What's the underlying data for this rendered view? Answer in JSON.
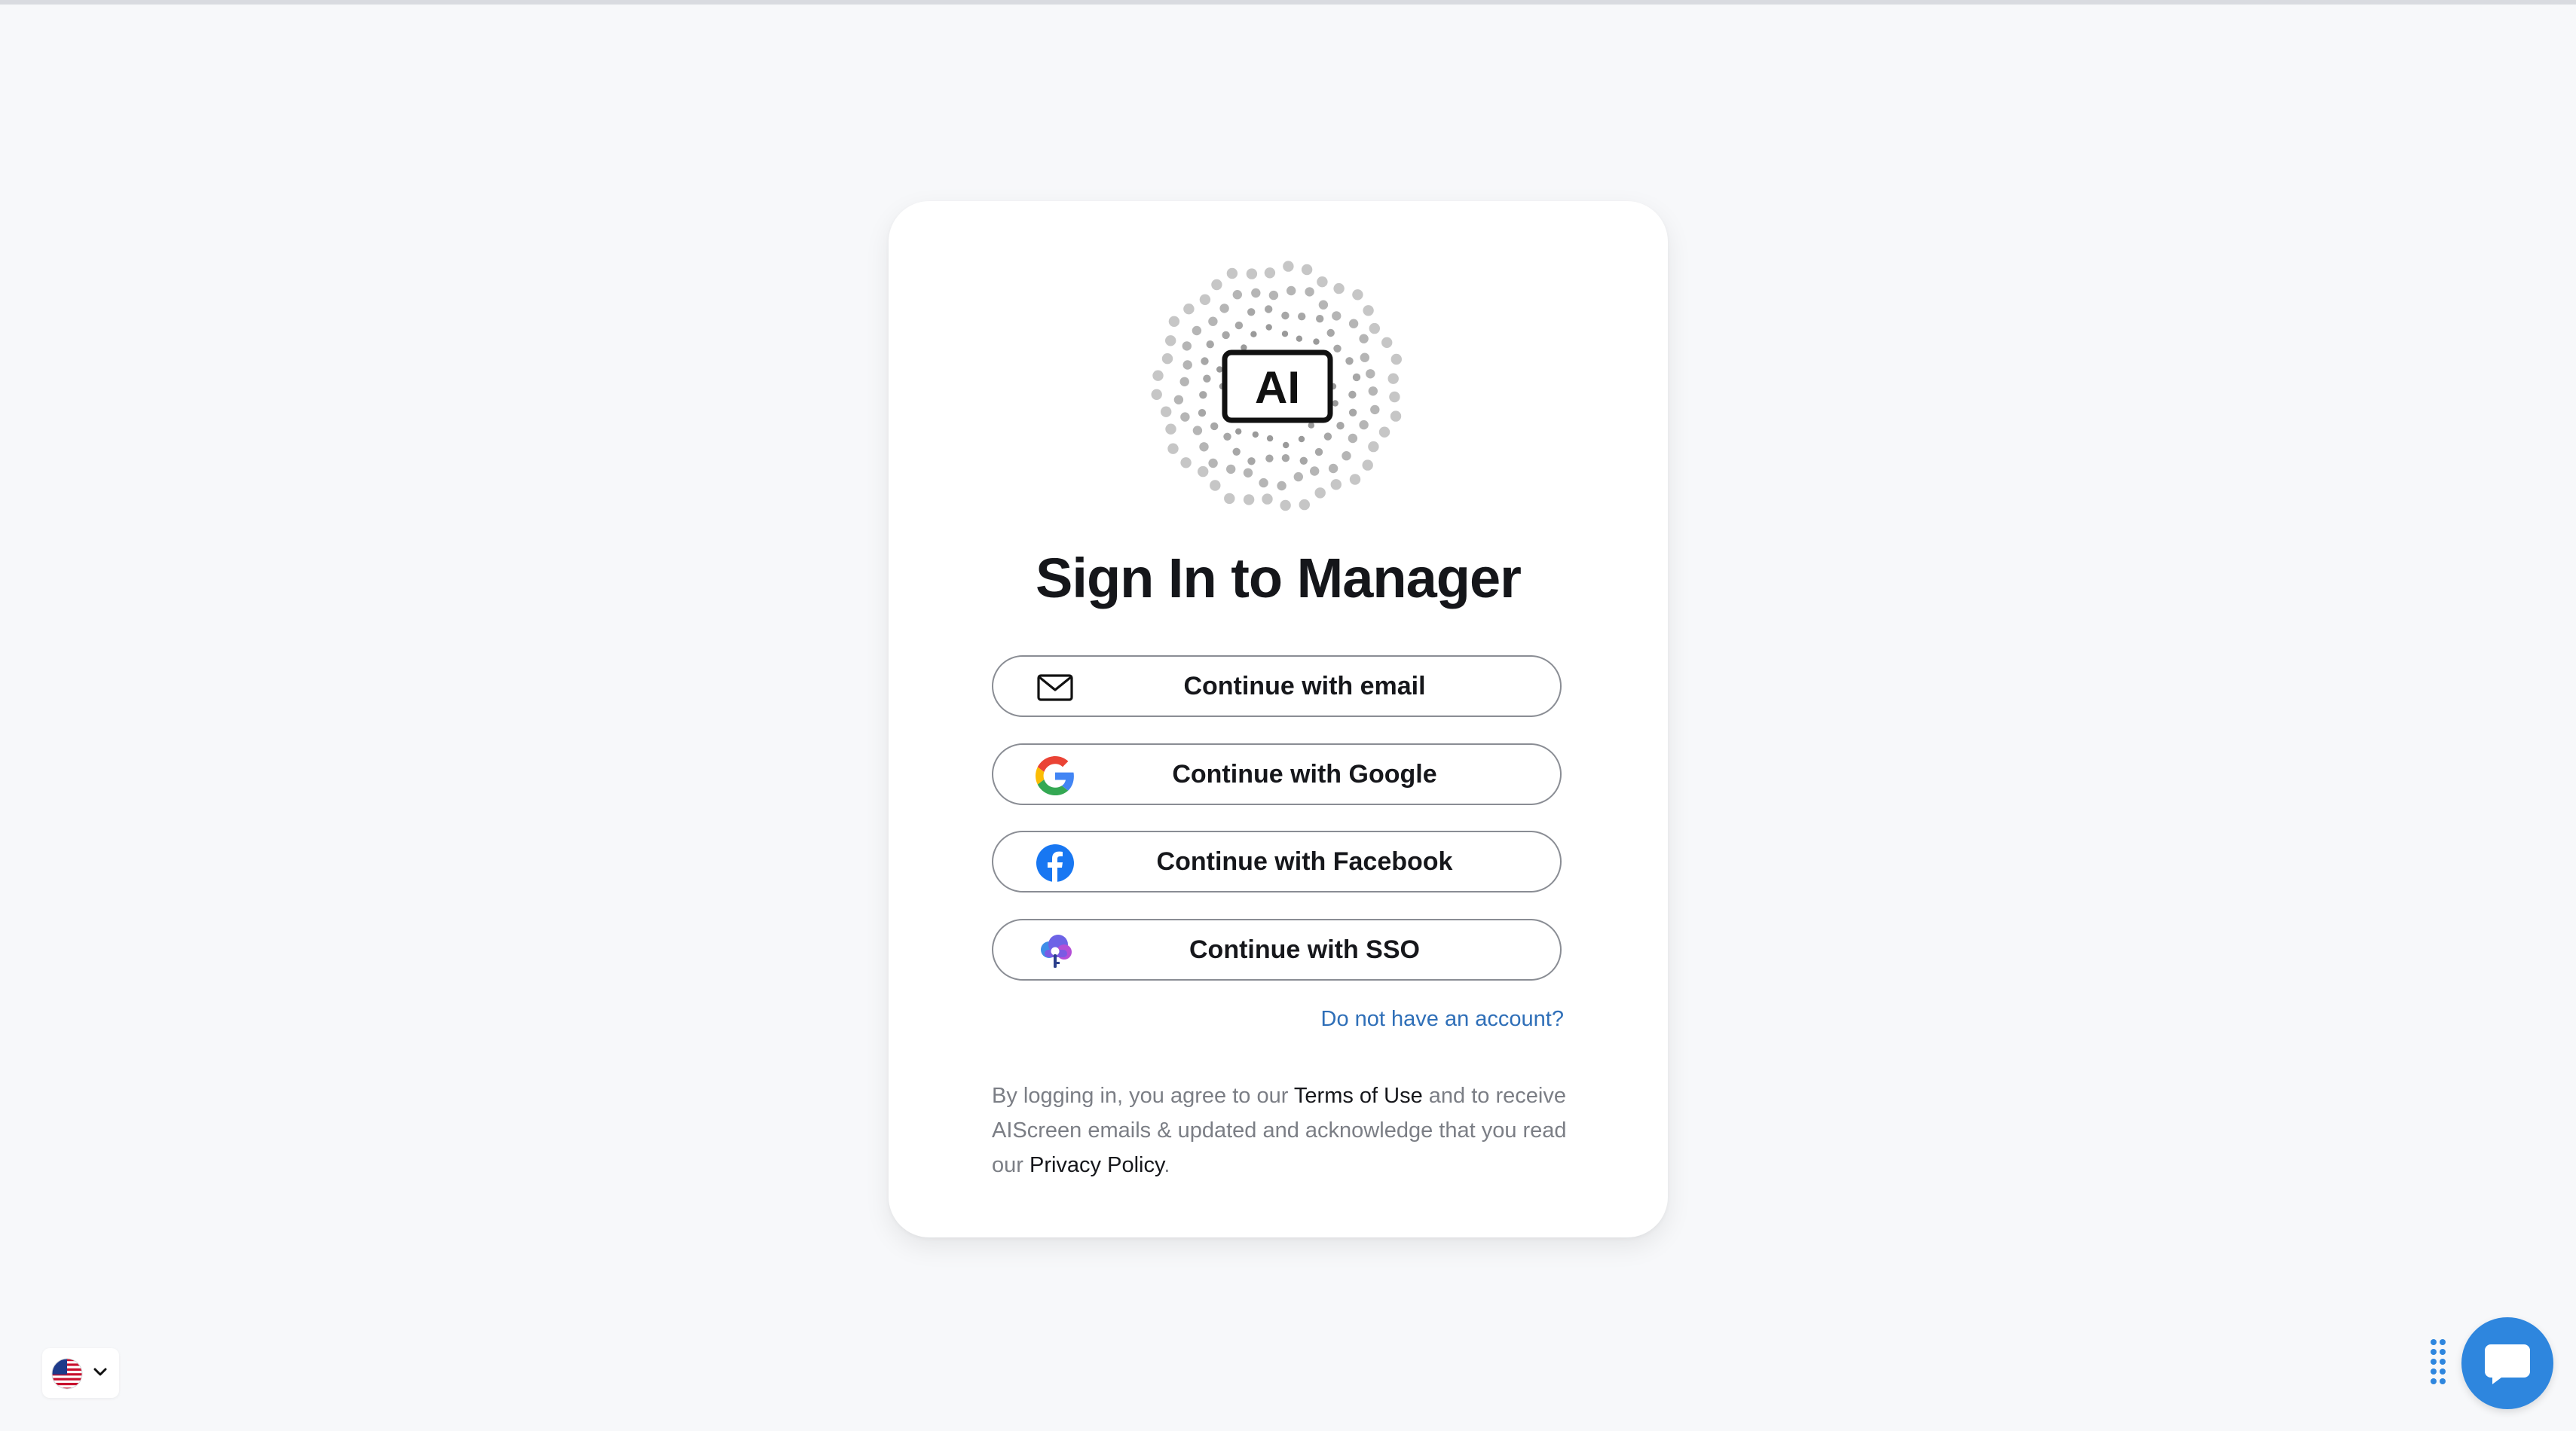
{
  "page": {
    "title": "Sign In to Manager"
  },
  "brand": {
    "logo_text": "AI",
    "logo_icon": "dotted-ring-ai-logo"
  },
  "auth_buttons": [
    {
      "label": "Continue with email",
      "icon": "mail-icon"
    },
    {
      "label": "Continue with Google",
      "icon": "google-icon"
    },
    {
      "label": "Continue with Facebook",
      "icon": "facebook-icon"
    },
    {
      "label": "Continue with SSO",
      "icon": "sso-cloud-key-icon"
    }
  ],
  "signup_link": "Do not have an account?",
  "legal": {
    "part1": "By logging in, you agree to our ",
    "terms_link": "Terms of Use",
    "part2": " and to receive AIScreen emails & updated and acknowledge that you read our ",
    "privacy_link": "Privacy Policy",
    "part3": "."
  },
  "language_selector": {
    "flag": "us-flag-icon",
    "chevron": "chevron-down-icon"
  },
  "chat_widget": {
    "icon": "chat-bubble-icon",
    "handle_icon": "drag-dots-icon"
  },
  "colors": {
    "link": "#2f6fb8",
    "chat": "#2e86de",
    "facebook": "#1877f2",
    "background": "#f7f8fa"
  }
}
